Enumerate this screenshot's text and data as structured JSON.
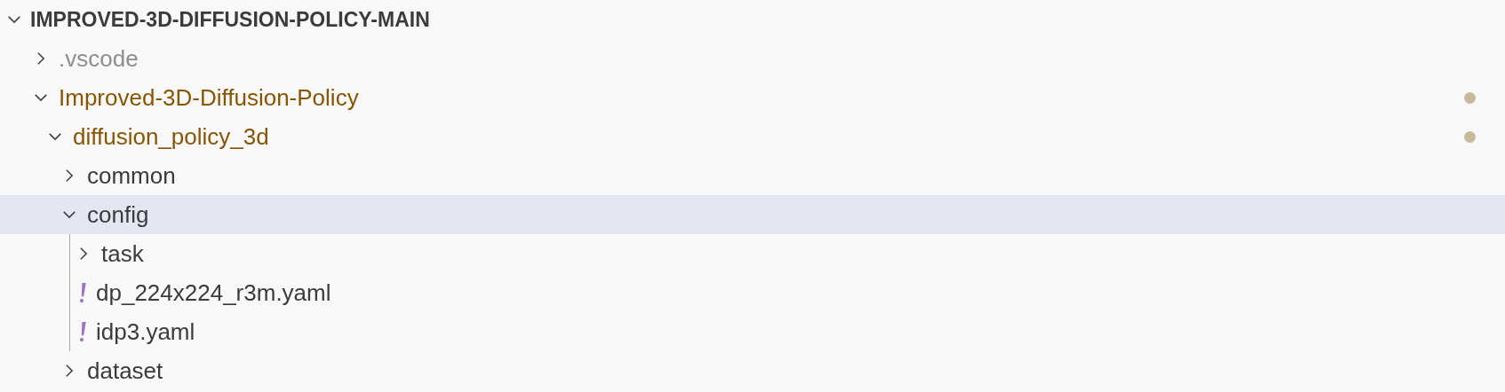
{
  "explorer": {
    "title": "IMPROVED-3D-DIFFUSION-POLICY-MAIN",
    "expanded": true,
    "tree": [
      {
        "name": ".vscode",
        "kind": "folder",
        "expanded": false,
        "selected": false,
        "ignored": true,
        "modified": false
      },
      {
        "name": "Improved-3D-Diffusion-Policy",
        "kind": "folder",
        "expanded": true,
        "selected": false,
        "ignored": false,
        "modified": true,
        "children": [
          {
            "name": "diffusion_policy_3d",
            "kind": "folder",
            "expanded": true,
            "selected": false,
            "ignored": false,
            "modified": true,
            "children": [
              {
                "name": "common",
                "kind": "folder",
                "expanded": false,
                "selected": false,
                "ignored": false,
                "modified": false
              },
              {
                "name": "config",
                "kind": "folder",
                "expanded": true,
                "selected": true,
                "ignored": false,
                "modified": false,
                "children": [
                  {
                    "name": "task",
                    "kind": "folder",
                    "expanded": false,
                    "selected": false,
                    "ignored": false,
                    "modified": false
                  },
                  {
                    "name": "dp_224x224_r3m.yaml",
                    "kind": "yaml",
                    "selected": false,
                    "ignored": false,
                    "modified": false
                  },
                  {
                    "name": "idp3.yaml",
                    "kind": "yaml",
                    "selected": false,
                    "ignored": false,
                    "modified": false
                  }
                ]
              },
              {
                "name": "dataset",
                "kind": "folder",
                "expanded": false,
                "selected": false,
                "ignored": false,
                "modified": false
              }
            ]
          }
        ]
      }
    ]
  }
}
